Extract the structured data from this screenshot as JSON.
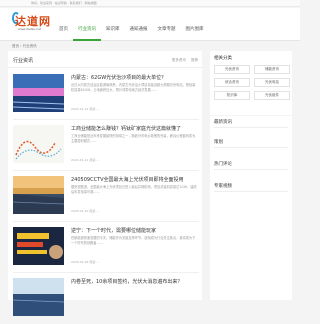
{
  "topbar": {
    "text": "你好，欢迎来到 · 站点导航 · 联系我们 · 网站地图"
  },
  "logo": {
    "text": "达道网",
    "url": "www.dadao.net"
  },
  "nav": [
    {
      "label": "首页",
      "active": false
    },
    {
      "label": "行业资讯",
      "active": true
    },
    {
      "label": "知识库",
      "active": false
    },
    {
      "label": "通知通报",
      "active": false
    },
    {
      "label": "文章专题",
      "active": false
    },
    {
      "label": "图片图库",
      "active": false
    }
  ],
  "breadcrumb": "首页  ›  行业资讯",
  "main": {
    "title": "行业资讯",
    "links": [
      "更多资讯",
      "推荐"
    ],
    "articles": [
      {
        "title": "内蒙古：62GW光伏治沙项目的最大单位？",
        "summary": "近日从内蒙古自治区能源局获悉，内蒙古光伏治沙项目将建设超大规模光伏电站，规划装机容量62GW，占地面积巨大，预计将带动地方经济发展……",
        "meta": "2024-01-12  阅读 ..."
      },
      {
        "title": "工商业储能怎么赚钱？钙钛矿家庭光伏这篇就懂了",
        "summary": "工商业储能是近年来发展最快的领域之一，随着分时电价政策的完善，峰谷价差套利成为主要盈利模式……",
        "meta": "2024-01-11  阅读 ..."
      },
      {
        "title": "240509CCTV全国最大海上光伏项目即将全面投用",
        "summary": "据央视报道，全国最大海上光伏项目已进入最后并网阶段，项目总装机容量达1GW，建成后年发电量可观……",
        "meta": "2024-01-10  阅读 ..."
      },
      {
        "title": "逆宁：下一个时代，需要哪位储能玩家",
        "summary": "在新能源快速发展的今天，储能作为关键支撑环节，逐渐成为行业关注焦点，谁将成为下一个时代的领跑者……",
        "meta": "2024-01-09  阅读 ..."
      },
      {
        "title": "内卷至死，10余项目签约，光伏大消息遍布出来？",
        "summary": "",
        "meta": ""
      }
    ]
  },
  "sidebar": {
    "tags_title": "相关分类",
    "tags": [
      "光伏资讯",
      "储能资讯",
      "综合资讯",
      "光伏电站",
      "知识库",
      "光伏组件"
    ],
    "sections": [
      "最新资讯",
      "策划",
      "热门评论",
      "专家视频"
    ]
  },
  "colors": {
    "accent": "#3aa537",
    "logo": "#d64b1a"
  }
}
